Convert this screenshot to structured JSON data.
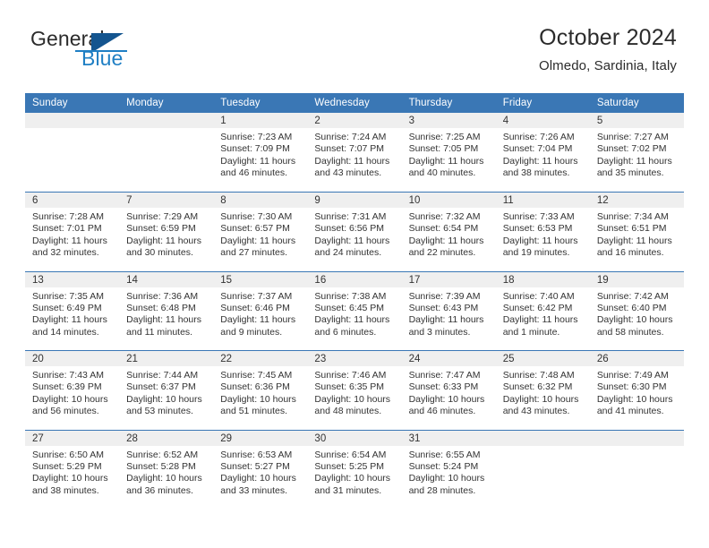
{
  "brand": {
    "name_top": "General",
    "name_bottom": "Blue",
    "logo_icon": "blue-triangle-logo",
    "accent_color": "#1f7fc4",
    "header_color": "#3a77b5"
  },
  "header": {
    "title": "October 2024",
    "subtitle": "Olmedo, Sardinia, Italy"
  },
  "weekdays": [
    "Sunday",
    "Monday",
    "Tuesday",
    "Wednesday",
    "Thursday",
    "Friday",
    "Saturday"
  ],
  "labels": {
    "sunrise_prefix": "Sunrise:",
    "sunset_prefix": "Sunset:",
    "daylight_prefix": "Daylight:"
  },
  "weeks": [
    [
      {
        "day": "",
        "sunrise": "",
        "sunset": "",
        "daylight_line1": "",
        "daylight_line2": ""
      },
      {
        "day": "",
        "sunrise": "",
        "sunset": "",
        "daylight_line1": "",
        "daylight_line2": ""
      },
      {
        "day": "1",
        "sunrise": "Sunrise: 7:23 AM",
        "sunset": "Sunset: 7:09 PM",
        "daylight_line1": "Daylight: 11 hours",
        "daylight_line2": "and 46 minutes."
      },
      {
        "day": "2",
        "sunrise": "Sunrise: 7:24 AM",
        "sunset": "Sunset: 7:07 PM",
        "daylight_line1": "Daylight: 11 hours",
        "daylight_line2": "and 43 minutes."
      },
      {
        "day": "3",
        "sunrise": "Sunrise: 7:25 AM",
        "sunset": "Sunset: 7:05 PM",
        "daylight_line1": "Daylight: 11 hours",
        "daylight_line2": "and 40 minutes."
      },
      {
        "day": "4",
        "sunrise": "Sunrise: 7:26 AM",
        "sunset": "Sunset: 7:04 PM",
        "daylight_line1": "Daylight: 11 hours",
        "daylight_line2": "and 38 minutes."
      },
      {
        "day": "5",
        "sunrise": "Sunrise: 7:27 AM",
        "sunset": "Sunset: 7:02 PM",
        "daylight_line1": "Daylight: 11 hours",
        "daylight_line2": "and 35 minutes."
      }
    ],
    [
      {
        "day": "6",
        "sunrise": "Sunrise: 7:28 AM",
        "sunset": "Sunset: 7:01 PM",
        "daylight_line1": "Daylight: 11 hours",
        "daylight_line2": "and 32 minutes."
      },
      {
        "day": "7",
        "sunrise": "Sunrise: 7:29 AM",
        "sunset": "Sunset: 6:59 PM",
        "daylight_line1": "Daylight: 11 hours",
        "daylight_line2": "and 30 minutes."
      },
      {
        "day": "8",
        "sunrise": "Sunrise: 7:30 AM",
        "sunset": "Sunset: 6:57 PM",
        "daylight_line1": "Daylight: 11 hours",
        "daylight_line2": "and 27 minutes."
      },
      {
        "day": "9",
        "sunrise": "Sunrise: 7:31 AM",
        "sunset": "Sunset: 6:56 PM",
        "daylight_line1": "Daylight: 11 hours",
        "daylight_line2": "and 24 minutes."
      },
      {
        "day": "10",
        "sunrise": "Sunrise: 7:32 AM",
        "sunset": "Sunset: 6:54 PM",
        "daylight_line1": "Daylight: 11 hours",
        "daylight_line2": "and 22 minutes."
      },
      {
        "day": "11",
        "sunrise": "Sunrise: 7:33 AM",
        "sunset": "Sunset: 6:53 PM",
        "daylight_line1": "Daylight: 11 hours",
        "daylight_line2": "and 19 minutes."
      },
      {
        "day": "12",
        "sunrise": "Sunrise: 7:34 AM",
        "sunset": "Sunset: 6:51 PM",
        "daylight_line1": "Daylight: 11 hours",
        "daylight_line2": "and 16 minutes."
      }
    ],
    [
      {
        "day": "13",
        "sunrise": "Sunrise: 7:35 AM",
        "sunset": "Sunset: 6:49 PM",
        "daylight_line1": "Daylight: 11 hours",
        "daylight_line2": "and 14 minutes."
      },
      {
        "day": "14",
        "sunrise": "Sunrise: 7:36 AM",
        "sunset": "Sunset: 6:48 PM",
        "daylight_line1": "Daylight: 11 hours",
        "daylight_line2": "and 11 minutes."
      },
      {
        "day": "15",
        "sunrise": "Sunrise: 7:37 AM",
        "sunset": "Sunset: 6:46 PM",
        "daylight_line1": "Daylight: 11 hours",
        "daylight_line2": "and 9 minutes."
      },
      {
        "day": "16",
        "sunrise": "Sunrise: 7:38 AM",
        "sunset": "Sunset: 6:45 PM",
        "daylight_line1": "Daylight: 11 hours",
        "daylight_line2": "and 6 minutes."
      },
      {
        "day": "17",
        "sunrise": "Sunrise: 7:39 AM",
        "sunset": "Sunset: 6:43 PM",
        "daylight_line1": "Daylight: 11 hours",
        "daylight_line2": "and 3 minutes."
      },
      {
        "day": "18",
        "sunrise": "Sunrise: 7:40 AM",
        "sunset": "Sunset: 6:42 PM",
        "daylight_line1": "Daylight: 11 hours",
        "daylight_line2": "and 1 minute."
      },
      {
        "day": "19",
        "sunrise": "Sunrise: 7:42 AM",
        "sunset": "Sunset: 6:40 PM",
        "daylight_line1": "Daylight: 10 hours",
        "daylight_line2": "and 58 minutes."
      }
    ],
    [
      {
        "day": "20",
        "sunrise": "Sunrise: 7:43 AM",
        "sunset": "Sunset: 6:39 PM",
        "daylight_line1": "Daylight: 10 hours",
        "daylight_line2": "and 56 minutes."
      },
      {
        "day": "21",
        "sunrise": "Sunrise: 7:44 AM",
        "sunset": "Sunset: 6:37 PM",
        "daylight_line1": "Daylight: 10 hours",
        "daylight_line2": "and 53 minutes."
      },
      {
        "day": "22",
        "sunrise": "Sunrise: 7:45 AM",
        "sunset": "Sunset: 6:36 PM",
        "daylight_line1": "Daylight: 10 hours",
        "daylight_line2": "and 51 minutes."
      },
      {
        "day": "23",
        "sunrise": "Sunrise: 7:46 AM",
        "sunset": "Sunset: 6:35 PM",
        "daylight_line1": "Daylight: 10 hours",
        "daylight_line2": "and 48 minutes."
      },
      {
        "day": "24",
        "sunrise": "Sunrise: 7:47 AM",
        "sunset": "Sunset: 6:33 PM",
        "daylight_line1": "Daylight: 10 hours",
        "daylight_line2": "and 46 minutes."
      },
      {
        "day": "25",
        "sunrise": "Sunrise: 7:48 AM",
        "sunset": "Sunset: 6:32 PM",
        "daylight_line1": "Daylight: 10 hours",
        "daylight_line2": "and 43 minutes."
      },
      {
        "day": "26",
        "sunrise": "Sunrise: 7:49 AM",
        "sunset": "Sunset: 6:30 PM",
        "daylight_line1": "Daylight: 10 hours",
        "daylight_line2": "and 41 minutes."
      }
    ],
    [
      {
        "day": "27",
        "sunrise": "Sunrise: 6:50 AM",
        "sunset": "Sunset: 5:29 PM",
        "daylight_line1": "Daylight: 10 hours",
        "daylight_line2": "and 38 minutes."
      },
      {
        "day": "28",
        "sunrise": "Sunrise: 6:52 AM",
        "sunset": "Sunset: 5:28 PM",
        "daylight_line1": "Daylight: 10 hours",
        "daylight_line2": "and 36 minutes."
      },
      {
        "day": "29",
        "sunrise": "Sunrise: 6:53 AM",
        "sunset": "Sunset: 5:27 PM",
        "daylight_line1": "Daylight: 10 hours",
        "daylight_line2": "and 33 minutes."
      },
      {
        "day": "30",
        "sunrise": "Sunrise: 6:54 AM",
        "sunset": "Sunset: 5:25 PM",
        "daylight_line1": "Daylight: 10 hours",
        "daylight_line2": "and 31 minutes."
      },
      {
        "day": "31",
        "sunrise": "Sunrise: 6:55 AM",
        "sunset": "Sunset: 5:24 PM",
        "daylight_line1": "Daylight: 10 hours",
        "daylight_line2": "and 28 minutes."
      },
      {
        "day": "",
        "sunrise": "",
        "sunset": "",
        "daylight_line1": "",
        "daylight_line2": ""
      },
      {
        "day": "",
        "sunrise": "",
        "sunset": "",
        "daylight_line1": "",
        "daylight_line2": ""
      }
    ]
  ]
}
